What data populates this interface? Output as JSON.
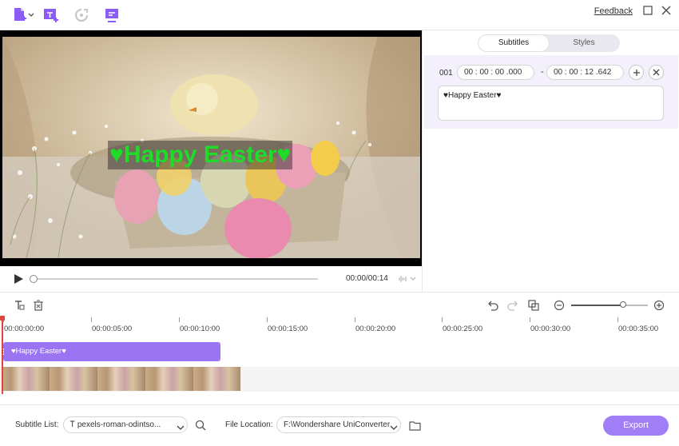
{
  "topbar": {
    "feedback_label": "Feedback"
  },
  "player": {
    "subtitle_overlay": "♥Happy Easter♥",
    "time": "00:00/00:14",
    "progress": 0.0
  },
  "panel": {
    "tabs": [
      "Subtitles",
      "Styles"
    ],
    "active_tab": "Subtitles",
    "entry": {
      "index": "001",
      "start": "00 : 00 : 00 .000",
      "end": "00 : 00 : 12 .642",
      "text": "♥Happy Easter♥"
    }
  },
  "timeline": {
    "ruler": [
      "00:00:00:00",
      "00:00:05:00",
      "00:00:10:00",
      "00:00:15:00",
      "00:00:20:00",
      "00:00:25:00",
      "00:00:30:00",
      "00:00:35:00"
    ],
    "subtitle_clip": "♥Happy Easter♥",
    "zoom_level": 0.68
  },
  "footer": {
    "subtitle_list_label": "Subtitle List:",
    "subtitle_list_value": "pexels-roman-odintso...",
    "file_location_label": "File Location:",
    "file_location_value": "F:\\Wondershare UniConverter",
    "export_label": "Export"
  },
  "colors": {
    "accent": "#9b74f4",
    "subtitle_green": "#1fdc2a",
    "playhead": "#e0443a"
  }
}
